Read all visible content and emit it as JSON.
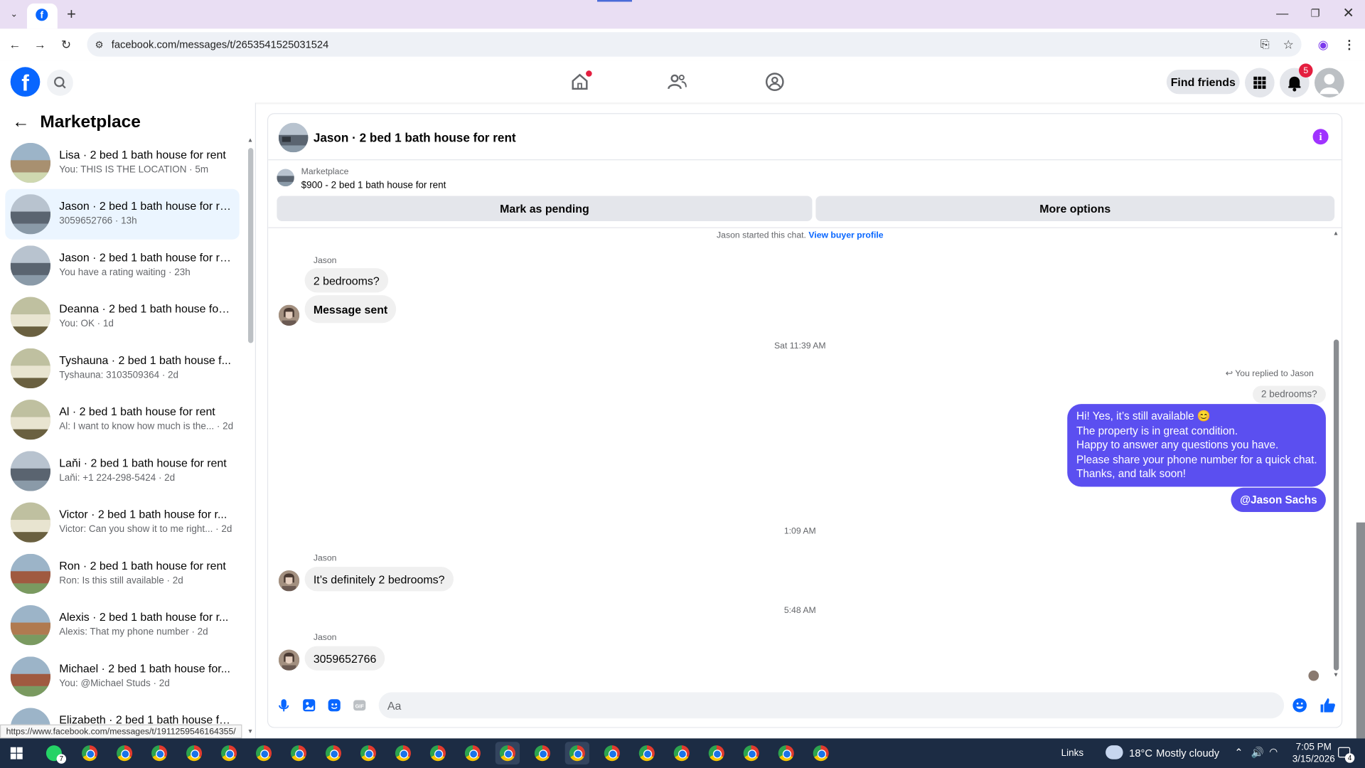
{
  "browser": {
    "url": "facebook.com/messages/t/2653541525031524",
    "status_url": "https://www.facebook.com/messages/t/1911259546164355/"
  },
  "header": {
    "find_friends": "Find friends",
    "notification_count": "5"
  },
  "sidebar": {
    "title": "Marketplace",
    "conversations": [
      {
        "name": "Lisa · 2 bed 1 bath house for rent",
        "preview": "You: THIS IS THE LOCATION · 5m",
        "selected": false
      },
      {
        "name": "Jason · 2 bed 1 bath house for re...",
        "preview": "3059652766 · 13h",
        "selected": true
      },
      {
        "name": "Jason · 2 bed 1 bath house for re...",
        "preview": "You have a rating waiting · 23h",
        "selected": false
      },
      {
        "name": "Deanna · 2 bed 1 bath house for ...",
        "preview": "You: OK · 1d",
        "selected": false
      },
      {
        "name": "Tyshauna · 2 bed 1 bath house f...",
        "preview": "Tyshauna: 3103509364 · 2d",
        "selected": false
      },
      {
        "name": "Al · 2 bed 1 bath house for rent",
        "preview": "Al: I want to know how much is the... · 2d",
        "selected": false
      },
      {
        "name": "Laňi · 2 bed 1 bath house for rent",
        "preview": "Laňi: +1 224-298-5424 · 2d",
        "selected": false
      },
      {
        "name": "Victor · 2 bed 1 bath house for r...",
        "preview": "Victor: Can you show it to me right... · 2d",
        "selected": false
      },
      {
        "name": "Ron · 2 bed 1 bath house for rent",
        "preview": "Ron: Is this still available · 2d",
        "selected": false
      },
      {
        "name": "Alexis · 2 bed 1 bath house for r...",
        "preview": "Alexis: That my phone number · 2d",
        "selected": false
      },
      {
        "name": "Michael · 2 bed 1 bath house for...",
        "preview": "You: @Michael Studs · 2d",
        "selected": false
      },
      {
        "name": "Elizabeth · 2 bed 1 bath house fo...",
        "preview": "",
        "selected": false
      }
    ]
  },
  "chat": {
    "title": "Jason · 2 bed 1 bath house for rent",
    "marketplace_label": "Marketplace",
    "listing": "$900 - 2 bed 1 bath house for rent",
    "mark_pending": "Mark as pending",
    "more_options": "More options",
    "started_text": "Jason started this chat.",
    "view_profile": "View buyer profile",
    "sender": "Jason",
    "msg1": "2 bedrooms?",
    "msg2": "Message sent",
    "time1": "Sat 11:39 AM",
    "replied_to": "You replied to Jason",
    "quoted": "2 bedrooms?",
    "out_lines": [
      "Hi! Yes, it’s still available 😊",
      "The property is in great condition.",
      "Happy to answer any questions you have.",
      "Please share your phone number for a quick chat.",
      "Thanks, and talk soon!"
    ],
    "mention": "@Jason Sachs",
    "time2": "1:09 AM",
    "msg3": "It’s definitely 2 bedrooms?",
    "time3": "5:48 AM",
    "msg4": "3059652766",
    "input_placeholder": "Aa"
  },
  "taskbar": {
    "links": "Links",
    "temp": "18°C",
    "weather": "Mostly cloudy",
    "time": "7:05 PM",
    "date": "3/15/2026",
    "whatsapp_count": "7",
    "notif_count": "4"
  },
  "colors": {
    "fb_blue": "#0866ff",
    "outgoing": "#5b4ff0",
    "info": "#a033ff"
  }
}
